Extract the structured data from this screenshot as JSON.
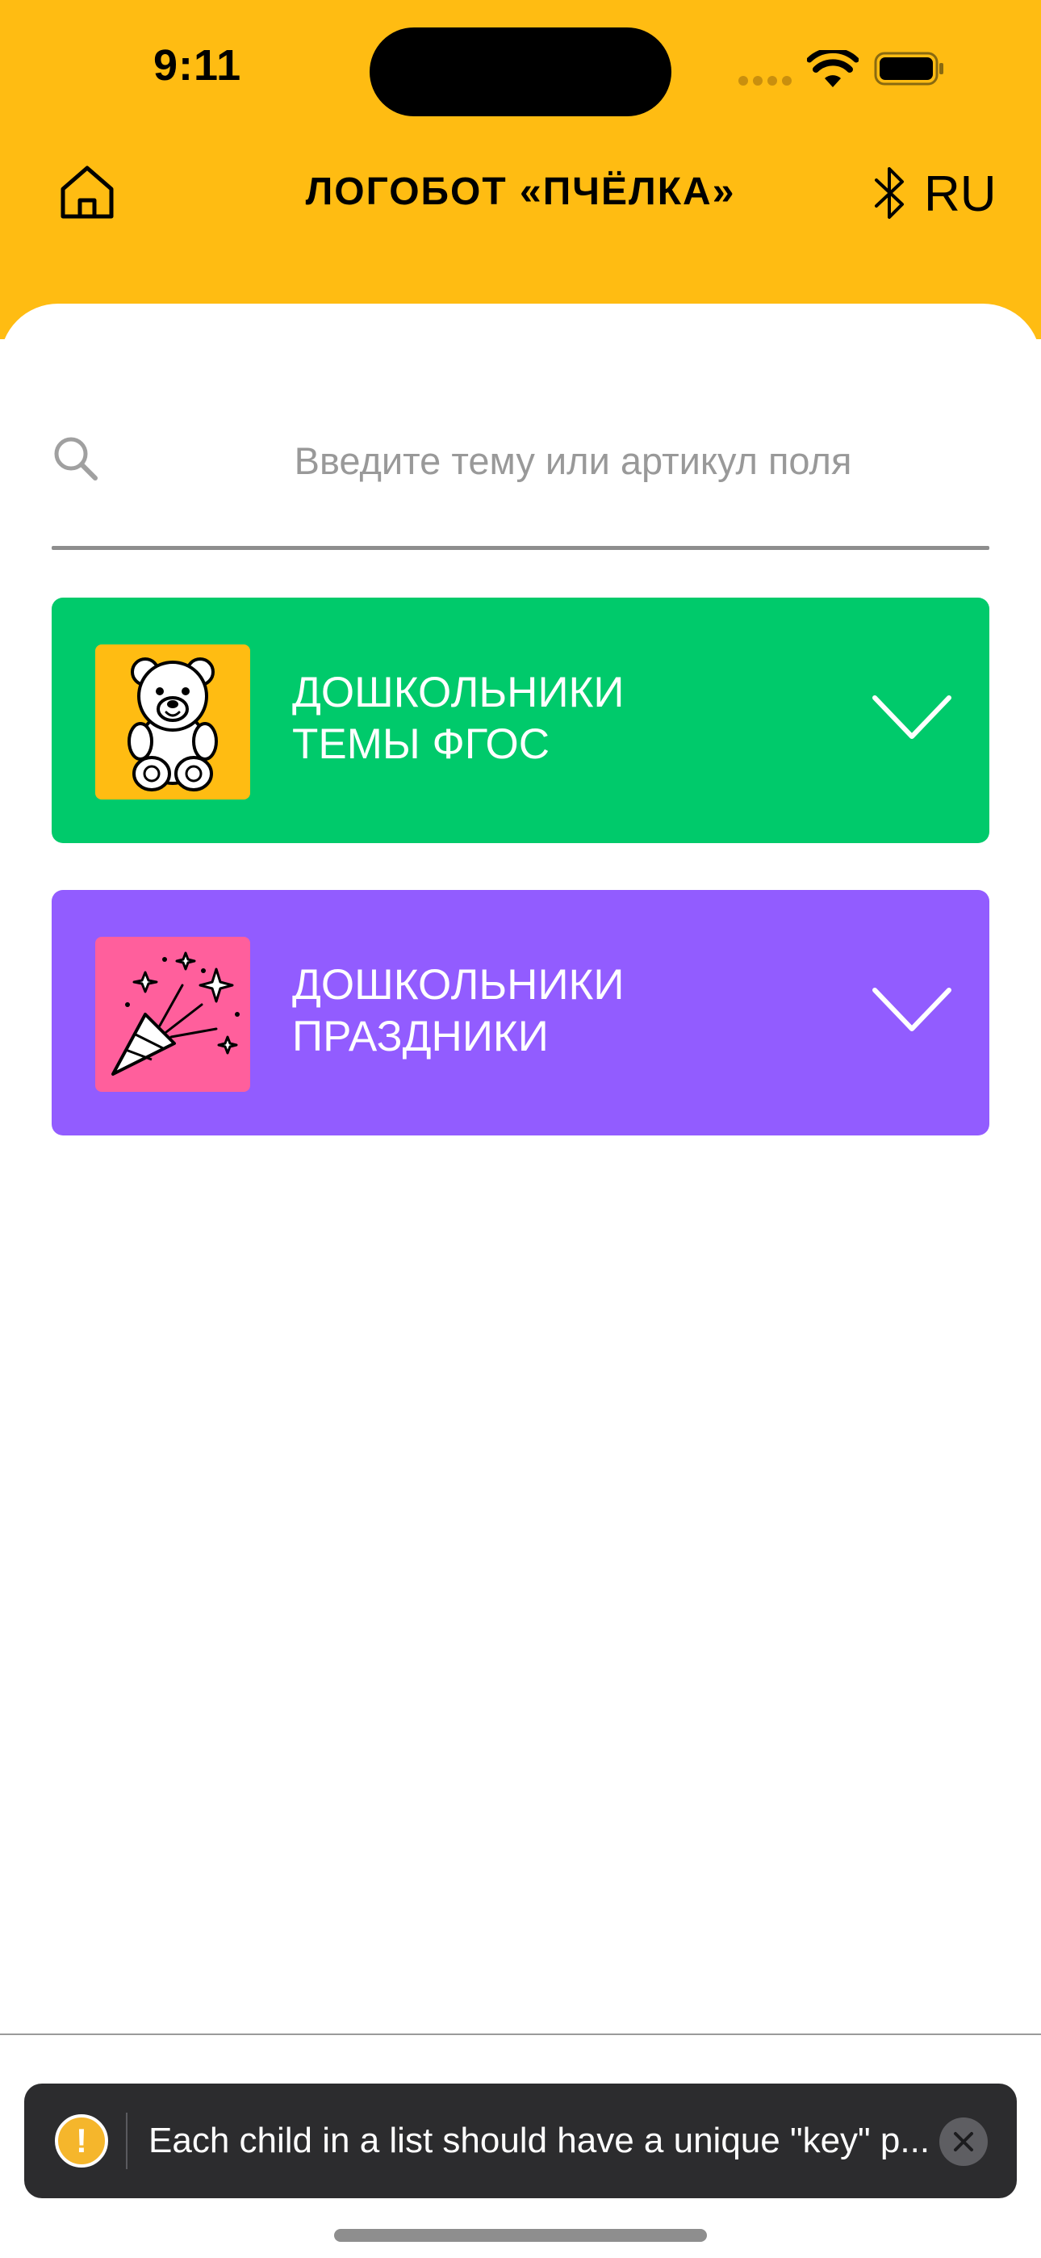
{
  "status_bar": {
    "time": "9:11"
  },
  "header": {
    "title": "ЛОГОБОТ «ПЧЁЛКА»",
    "language": "RU",
    "background_color": "#FFBC12",
    "icons": {
      "home": "home-icon",
      "bluetooth": "bluetooth-icon"
    }
  },
  "search": {
    "placeholder": "Введите тему или артикул поля",
    "value": "",
    "icon": "search-icon"
  },
  "categories": [
    {
      "line1": "ДОШКОЛЬНИКИ",
      "line2": "ТЕМЫ ФГОС",
      "color": "#00CA6B",
      "thumb_color": "#FFBC12",
      "icon": "teddy-bear-icon"
    },
    {
      "line1": "ДОШКОЛЬНИКИ",
      "line2": "ПРАЗДНИКИ",
      "color": "#925CFF",
      "thumb_color": "#FF5F9C",
      "icon": "party-popper-icon"
    }
  ],
  "toast": {
    "message": "Each child in a list should have a unique \"key\" p...",
    "icon": "warning-icon"
  }
}
